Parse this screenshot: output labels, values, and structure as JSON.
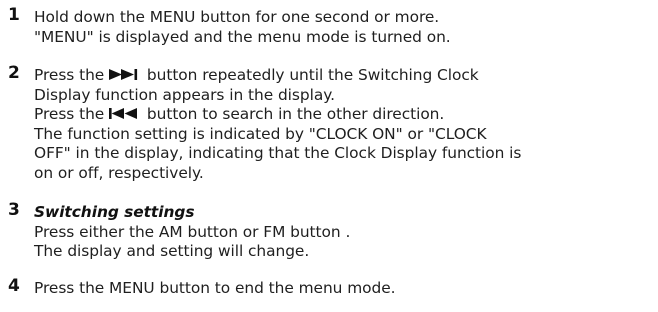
{
  "steps": [
    {
      "number": "1",
      "lines": [
        "Hold down the MENU button for one second or more.",
        "\"MENU\" is displayed and the menu mode is turned on."
      ]
    },
    {
      "number": "2",
      "line1_prefix": "Press the ",
      "line1_suffix": " button repeatedly until the Switching Clock",
      "line2": "Display function appears in the display.",
      "line3_prefix": "Press the ",
      "line3_suffix": " button to search in the other direction.",
      "lines_after": [
        "The function setting is indicated by \"CLOCK ON\" or \"CLOCK",
        "OFF\" in the display, indicating that the Clock Display function is",
        "on or off, respectively."
      ]
    },
    {
      "number": "3",
      "heading": "Switching settings",
      "lines": [
        "Press either the AM button or FM button .",
        "The display and setting will change."
      ]
    },
    {
      "number": "4",
      "lines": [
        "Press the MENU button to end the menu mode."
      ]
    }
  ],
  "icons": {
    "next": "next-track-icon",
    "prev": "previous-track-icon"
  }
}
